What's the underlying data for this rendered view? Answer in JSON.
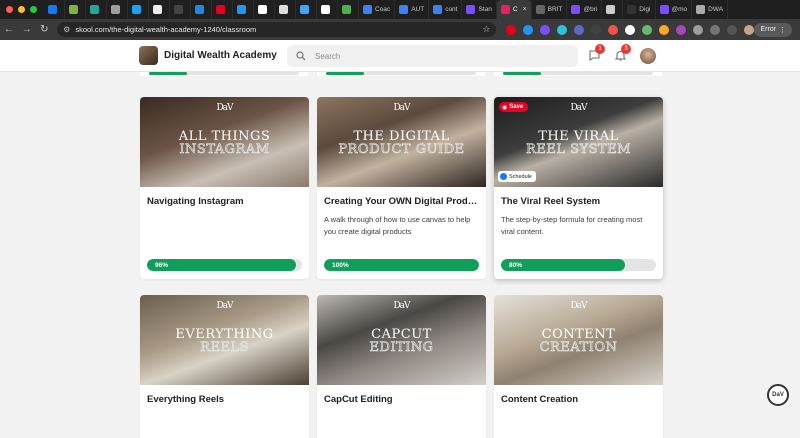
{
  "browser": {
    "tabs": [
      {
        "title": "",
        "color": "#1877f2"
      },
      {
        "title": "",
        "color": "#7cb342"
      },
      {
        "title": "",
        "color": "#26a69a"
      },
      {
        "title": "",
        "color": "#9e9e9e"
      },
      {
        "title": "",
        "color": "#1da1f2"
      },
      {
        "title": "",
        "color": "#eeeeee"
      },
      {
        "title": "",
        "color": "#444444"
      },
      {
        "title": "",
        "color": "#1e88e5"
      },
      {
        "title": "",
        "color": "#e60023"
      },
      {
        "title": "",
        "color": "#2196f3"
      },
      {
        "title": "",
        "color": "#ffffff"
      },
      {
        "title": "",
        "color": "#dddddd"
      },
      {
        "title": "",
        "color": "#42a5f5"
      },
      {
        "title": "",
        "color": "#ffffff"
      },
      {
        "title": "",
        "color": "#4caf50"
      },
      {
        "title": "Coac",
        "color": "#3b82f6"
      },
      {
        "title": "AUT",
        "color": "#3b82f6"
      },
      {
        "title": "cont",
        "color": "#3b82f6"
      },
      {
        "title": "Stan",
        "color": "#7c4dff"
      },
      {
        "title": "C",
        "color": "#e91e63",
        "active": true
      },
      {
        "title": "BRIT",
        "color": "#666666"
      },
      {
        "title": "@bri",
        "color": "#7c4dff"
      },
      {
        "title": "",
        "color": "#cccccc"
      },
      {
        "title": "Digi",
        "color": "#333333"
      },
      {
        "title": "@mo",
        "color": "#7c4dff"
      },
      {
        "title": "DWA",
        "color": "#aaaaaa"
      }
    ],
    "url": "skool.com/the-digital-wealth-academy-1240/classroom",
    "error_label": "Error"
  },
  "header": {
    "community_name": "Digital Wealth Academy",
    "search_placeholder": "Search",
    "chat_badge": "1",
    "notification_badge": "3"
  },
  "courses": [
    {
      "title": "Navigating Instagram",
      "description": "",
      "progress": 96,
      "progress_label": "96%",
      "thumb_logo": "DaV",
      "thumb_line1": "ALL THINGS",
      "thumb_line2": "INSTAGRAM",
      "thumb_bg": "linear-gradient(160deg,#3a2a22 0%,#6b5446 40%,#c9bfb5 70%,#8a7a6c 100%)"
    },
    {
      "title": "Creating Your OWN Digital Produc...",
      "description": "A walk through of how to use canvas to help you create digital products",
      "progress": 100,
      "progress_label": "100%",
      "thumb_logo": "DaV",
      "thumb_line1": "THE DIGITAL",
      "thumb_line2": "PRODUCT GUIDE",
      "thumb_bg": "linear-gradient(160deg,#8c7560 0%,#5b4a3d 35%,#c2b2a0 60%,#2d2520 100%)"
    },
    {
      "title": "The Viral Reel System",
      "description": "The step-by-step formula for creating most viral content.",
      "progress": 80,
      "progress_label": "80%",
      "thumb_logo": "DaV",
      "thumb_line1": "THE VIRAL",
      "thumb_line2": "REEL SYSTEM",
      "thumb_bg": "linear-gradient(160deg,#1c1c1c 0%,#3d3d3d 40%,#b9b0a4 55%,#2a2a2a 100%)",
      "save_label": "Save",
      "schedule_label": "Schedule"
    },
    {
      "title": "Everything Reels",
      "thumb_logo": "DaV",
      "thumb_line1": "EVERYTHING",
      "thumb_line2": "REELS",
      "thumb_bg": "linear-gradient(160deg,#6b5e4e 0%,#a89a86 40%,#d9d2c6 60%,#4a4034 100%)"
    },
    {
      "title": "CapCut Editing",
      "thumb_logo": "DaV",
      "thumb_line1": "CAPCUT",
      "thumb_line2": "EDITING",
      "thumb_bg": "linear-gradient(160deg,#bdb8b2 0%,#4a4744 35%,#8c8580 60%,#d4cfc9 100%)"
    },
    {
      "title": "Content Creation",
      "thumb_logo": "DaV",
      "thumb_line1": "CONTENT",
      "thumb_line2": "CREATION",
      "thumb_bg": "linear-gradient(160deg,#e6e1da 0%,#b7a994 40%,#8f8170 60%,#d8d2ca 100%)"
    }
  ]
}
